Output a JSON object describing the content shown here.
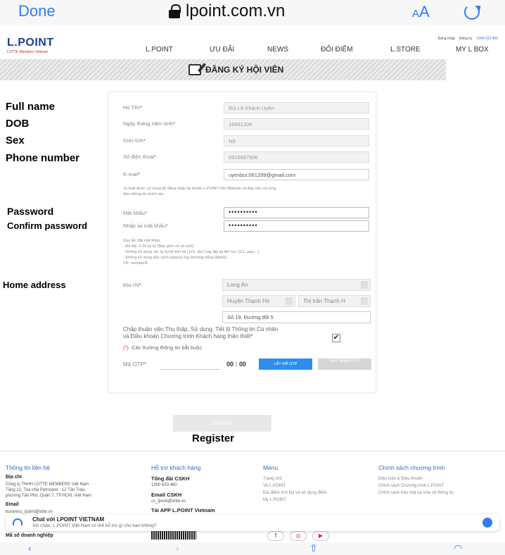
{
  "safari": {
    "done": "Done",
    "url": "lpoint.com.vn",
    "aa_small": "A",
    "aa_large": "A"
  },
  "header": {
    "logo": "L.POINT",
    "logo_sub": "LOTTE Members Vietnam",
    "login": "Đăng nhập",
    "signup": "Đăng ký",
    "phone": "1900 633 460",
    "nav": [
      "L.POINT",
      "ƯU ĐÃI",
      "NEWS",
      "ĐỐI ĐIỂM",
      "L.STORE",
      "MY L BOX"
    ]
  },
  "banner": {
    "title": "ĐĂNG KÝ HỘI VIÊN"
  },
  "annotations": {
    "full_name": "Full name",
    "dob": "DOB",
    "sex": "Sex",
    "phone": "Phone number",
    "password": "Password",
    "confirm": "Confirm password",
    "address": "Home address",
    "register": "Register"
  },
  "form": {
    "name_label": "Họ Tên",
    "name_value": "Bùi Lê Khánh Uyên",
    "dob_label": "Ngày tháng năm sinh",
    "dob_value": "19991206",
    "sex_label": "Giới tính",
    "sex_value": "Nữ",
    "phone_label": "Số điện thoại",
    "phone_value": "0916687506",
    "email_label": "E-mail",
    "email_value": "uyenbui.061299@gmail.com",
    "email_note_1": "-E-mail được sử dụng để đăng nhập tài khoản L.POINT trên Website và App nên vui lòng",
    "email_note_2": "điền thông tin chính xác.",
    "pwd_label": "Mật khẩu",
    "pwd_value": "••••••••••",
    "pwd2_label": "Nhập lại mật khẩu",
    "pwd2_value": "••••••••••",
    "rules": [
      "Quy tắc đặt mật khẩu:",
      "- Độ dài: 6-20 ký tự (Bao gồm số và chữ).",
      "- Không sử dụng các ký tự/số liền kề (123, abc) hay lặp lại liên tục (111, aaa,...).",
      "- Không sử dụng dấu cách (space) hay khoảng trắng (blank).",
      "VD: member8!"
    ],
    "address_label": "Địa chỉ",
    "province": "Long An",
    "district": "Huyện Thạnh Hó",
    "ward": "Thị trấn Thạnh H",
    "street": "Số 19, Đường đối 5",
    "agree_1": "Chấp thuận việc Thu thập, Sử dụng, Tiết lộ Thông tin Cá nhân",
    "agree_2": "và Điều khoản Chương trình Khách hàng thân thiết",
    "check": "✔",
    "required_note": "Các trường thông tin bắt buộc",
    "otp_label": "Mã OTP",
    "otp_timer": "00 : 00",
    "otp_button": "LẤY MÃ OTP",
    "otp_button2": "XÁC NHẬN OTP",
    "register": "Đăng ký"
  },
  "footer": {
    "col1_title": "Thông tin liên hệ",
    "col1_lines": [
      "Địa chỉ",
      "Công ty TNHH LOTTE MEMBERS Việt Nam",
      "Tầng 12, Tòa nhà Petroland - 12 Tân Trào,",
      "phường Tân Phú, Quận 7, TP.HCM, Việt Nam"
    ],
    "email_title": "Email",
    "email_value": "business_lpoint@lotte.vn",
    "tax_title": "Mã số doanh nghiệp",
    "col2_title": "Hỗ trợ khách hàng",
    "hotline_title": "Tổng đài CSKH",
    "hotline": "1900 633 460",
    "cskh_email_title": "Email CSKH",
    "cskh_email": "cs_lpoint@lotte.vn",
    "app_title": "Tải APP L.POINT Vietnam",
    "col3_title": "Menu",
    "col3_items": [
      "Trang chủ",
      "Về L.POINT",
      "Địa điểm tích lũy và sử dụng điểm",
      "My L.POINT"
    ],
    "col4_title": "Chính sách chương trình",
    "col4_items": [
      "Điều kiện & Điều khoản",
      "Chính sách Chương trình L.POINT",
      "Chính sách bảo mật và chia sẻ thông tin"
    ]
  },
  "chat": {
    "title": "Chat với LPOINT VIETNAM",
    "subtitle": "Xin chào, L.POINT Việt Nam có thể hỗ trợ gì cho bạn không?"
  },
  "colors": {
    "accent": "#2f7cf6",
    "required": "#dd3333",
    "brand": "#1b3f8f"
  }
}
